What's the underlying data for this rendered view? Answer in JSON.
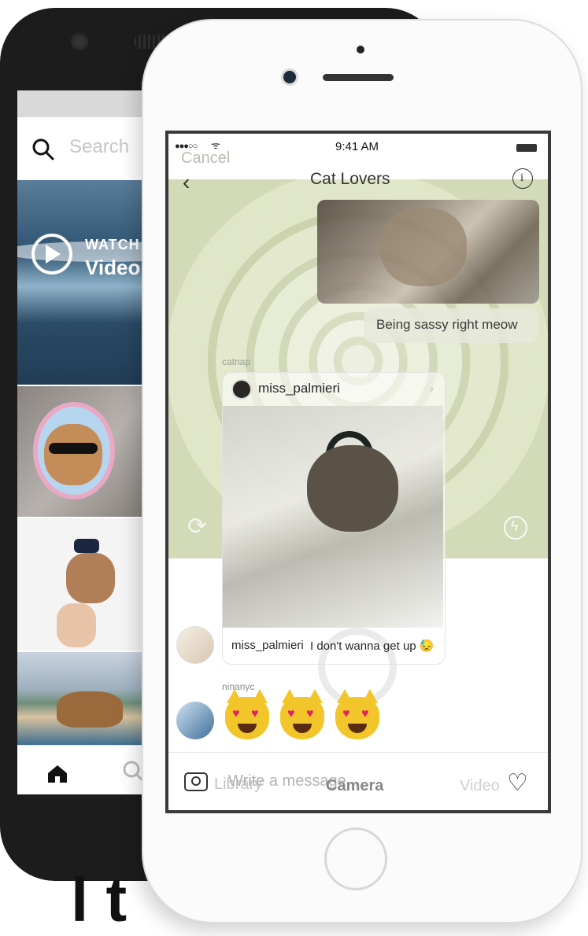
{
  "android": {
    "search_placeholder": "Search",
    "video_tile": {
      "eyebrow": "WATCH",
      "title": "Video"
    }
  },
  "status": {
    "time": "9:41 AM",
    "signal": "●●●○○",
    "wifi": "ᯤ"
  },
  "header": {
    "title": "Cat Lovers",
    "overlay_cancel": "Cancel"
  },
  "messages": {
    "sassy": "Being sassy right meow",
    "shared_post": {
      "sender": "catnap",
      "author": "miss_palmieri",
      "caption_user": "miss_palmieri",
      "caption_text": "I don't wanna get up 😓"
    },
    "emoji_reply": {
      "sender": "ninanyc"
    }
  },
  "composer": {
    "placeholder": "Write a message...",
    "tabs": {
      "library": "Library",
      "camera": "Camera",
      "video": "Video"
    }
  },
  "bottom_text": "l    t",
  "icons": {
    "search": "search-icon",
    "play": "play-icon",
    "home": "home-icon",
    "back": "chevron-left-icon",
    "info": "info-icon",
    "camera": "camera-icon",
    "heart": "heart-icon",
    "rotate": "rotate-camera-icon",
    "flash": "flash-icon"
  }
}
